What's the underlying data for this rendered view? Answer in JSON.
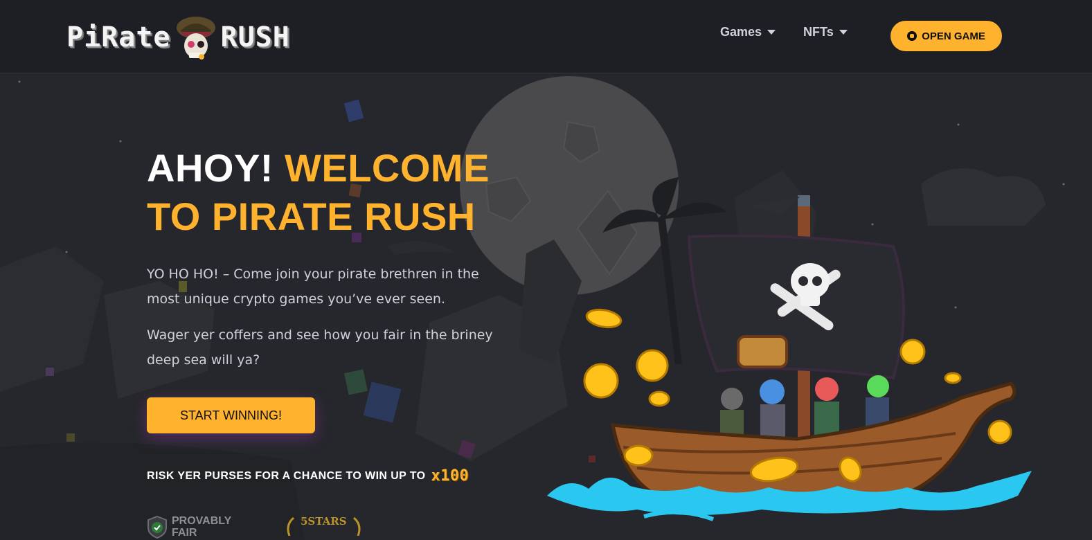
{
  "header": {
    "logo_left": "PiRate",
    "logo_right": "RUSH",
    "nav": [
      {
        "label": "Games"
      },
      {
        "label": "NFTs"
      }
    ],
    "cta_label": "OPEN GAME"
  },
  "hero": {
    "title_white": "AHOY!",
    "title_gold_1": "WELCOME",
    "title_gold_2": "TO PIRATE RUSH",
    "paragraph_1": "YO HO HO! – Come join your pirate brethren in the most unique crypto games you’ve ever seen.",
    "paragraph_2": "Wager yer coffers and see how you fair in the briney deep sea will ya?",
    "start_button": "START WINNING!",
    "risk_text": "RISK YER PURSES FOR A CHANCE TO WIN UP TO",
    "multiplier": "x100"
  },
  "badges": {
    "provably_fair": "PROVABLY FAIR",
    "stars": "5STARS"
  },
  "colors": {
    "accent": "#ffb22e",
    "background": "#26272c",
    "header": "#1e1f24"
  }
}
